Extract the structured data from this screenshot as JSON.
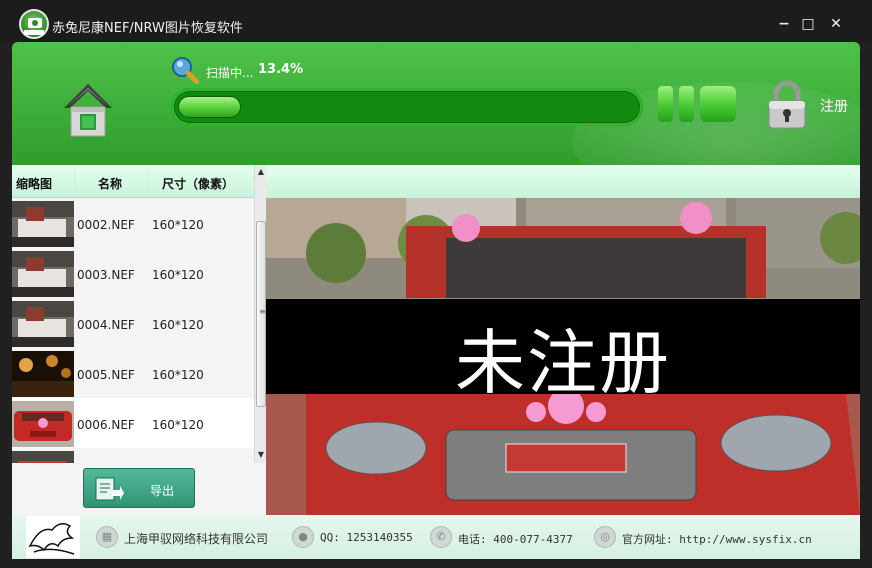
{
  "window": {
    "title": "赤兔尼康NEF/NRW图片恢复软件",
    "controls": {
      "minimize": "−",
      "maximize": "□",
      "close": "✕"
    }
  },
  "header": {
    "scan_label": "扫描中...",
    "scan_percent": "13.4%",
    "progress_fraction": 0.134,
    "register_label": "注册",
    "accent_color": "#3fb03b"
  },
  "file_list": {
    "columns": [
      "缩略图",
      "名称",
      "尺寸（像素）"
    ],
    "rows": [
      {
        "name": "0002.NEF",
        "size": "160*120",
        "thumb": "room"
      },
      {
        "name": "0003.NEF",
        "size": "160*120",
        "thumb": "room"
      },
      {
        "name": "0004.NEF",
        "size": "160*120",
        "thumb": "room"
      },
      {
        "name": "0005.NEF",
        "size": "160*120",
        "thumb": "night"
      },
      {
        "name": "0006.NEF",
        "size": "160*120",
        "thumb": "car",
        "selected": true
      },
      {
        "name": "",
        "size": "",
        "thumb": "room"
      }
    ]
  },
  "export_button": {
    "label": "导出"
  },
  "preview": {
    "watermark": "未注册"
  },
  "footer": {
    "company": "上海甲驭网络科技有限公司",
    "qq": "QQ: 1253140355",
    "phone": "电话: 400-077-4377",
    "website": "官方网址: http://www.sysfix.cn"
  }
}
